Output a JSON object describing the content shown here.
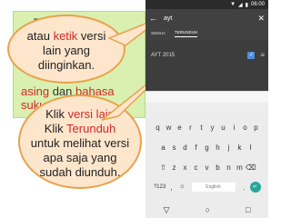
{
  "slide": {
    "frag_top": "T",
    "frag_bottom_red": "asing",
    "frag_bottom_mid": " dan ",
    "frag_bottom_red2": "bahasa suku",
    "frag_bottom_end": ".",
    "bubble1": {
      "line1_pre": "atau ",
      "line1_red": "ketik",
      "line1_post": " versi",
      "line2": "lain yang",
      "line3": "diinginkan."
    },
    "bubble2": {
      "line1_pre": "Klik ",
      "line1_red": "versi lain",
      "line2_pre": "Klik ",
      "line2_red": "Terunduh",
      "line3": "untuk melihat versi",
      "line4": "apa saja yang",
      "line5": "sudah diunduh."
    }
  },
  "phone": {
    "status_time": "06:00",
    "search_query": "ayt",
    "tabs": [
      "SEMUA",
      "TERUNDUH"
    ],
    "active_tab": "TERUNDUH",
    "list_item": "AYT 2015",
    "keyboard_row1": [
      "q",
      "w",
      "e",
      "r",
      "t",
      "y",
      "u",
      "i",
      "o",
      "p"
    ],
    "keyboard_row2": [
      "a",
      "s",
      "d",
      "f",
      "g",
      "h",
      "j",
      "k",
      "l"
    ],
    "keyboard_row3": [
      "z",
      "x",
      "c",
      "v",
      "b",
      "n",
      "m"
    ],
    "key_symbols": "?123",
    "key_comma": ",",
    "space_label": "English",
    "key_period": "."
  }
}
